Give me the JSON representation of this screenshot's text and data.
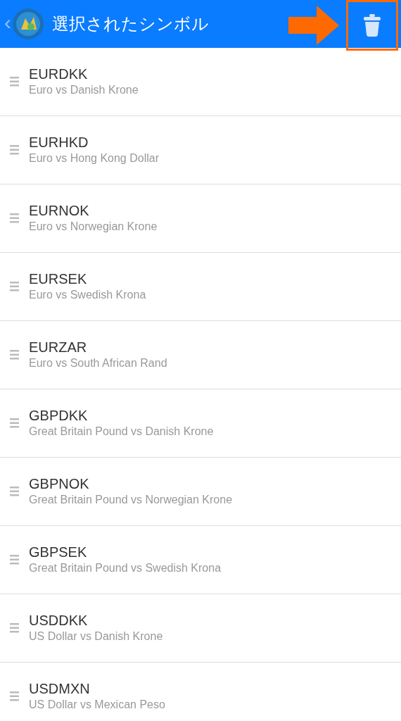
{
  "header": {
    "back": "‹",
    "title": "選択されたシンボル"
  },
  "symbols": [
    {
      "code": "EURDKK",
      "description": "Euro vs Danish Krone"
    },
    {
      "code": "EURHKD",
      "description": "Euro vs Hong Kong Dollar"
    },
    {
      "code": "EURNOK",
      "description": "Euro vs Norwegian Krone"
    },
    {
      "code": "EURSEK",
      "description": "Euro vs Swedish Krona"
    },
    {
      "code": "EURZAR",
      "description": "Euro vs South African Rand"
    },
    {
      "code": "GBPDKK",
      "description": "Great Britain Pound vs Danish Krone"
    },
    {
      "code": "GBPNOK",
      "description": "Great Britain Pound vs Norwegian Krone"
    },
    {
      "code": "GBPSEK",
      "description": "Great Britain Pound vs Swedish Krona"
    },
    {
      "code": "USDDKK",
      "description": "US Dollar vs Danish Krone"
    },
    {
      "code": "USDMXN",
      "description": "US Dollar vs Mexican Peso"
    }
  ]
}
